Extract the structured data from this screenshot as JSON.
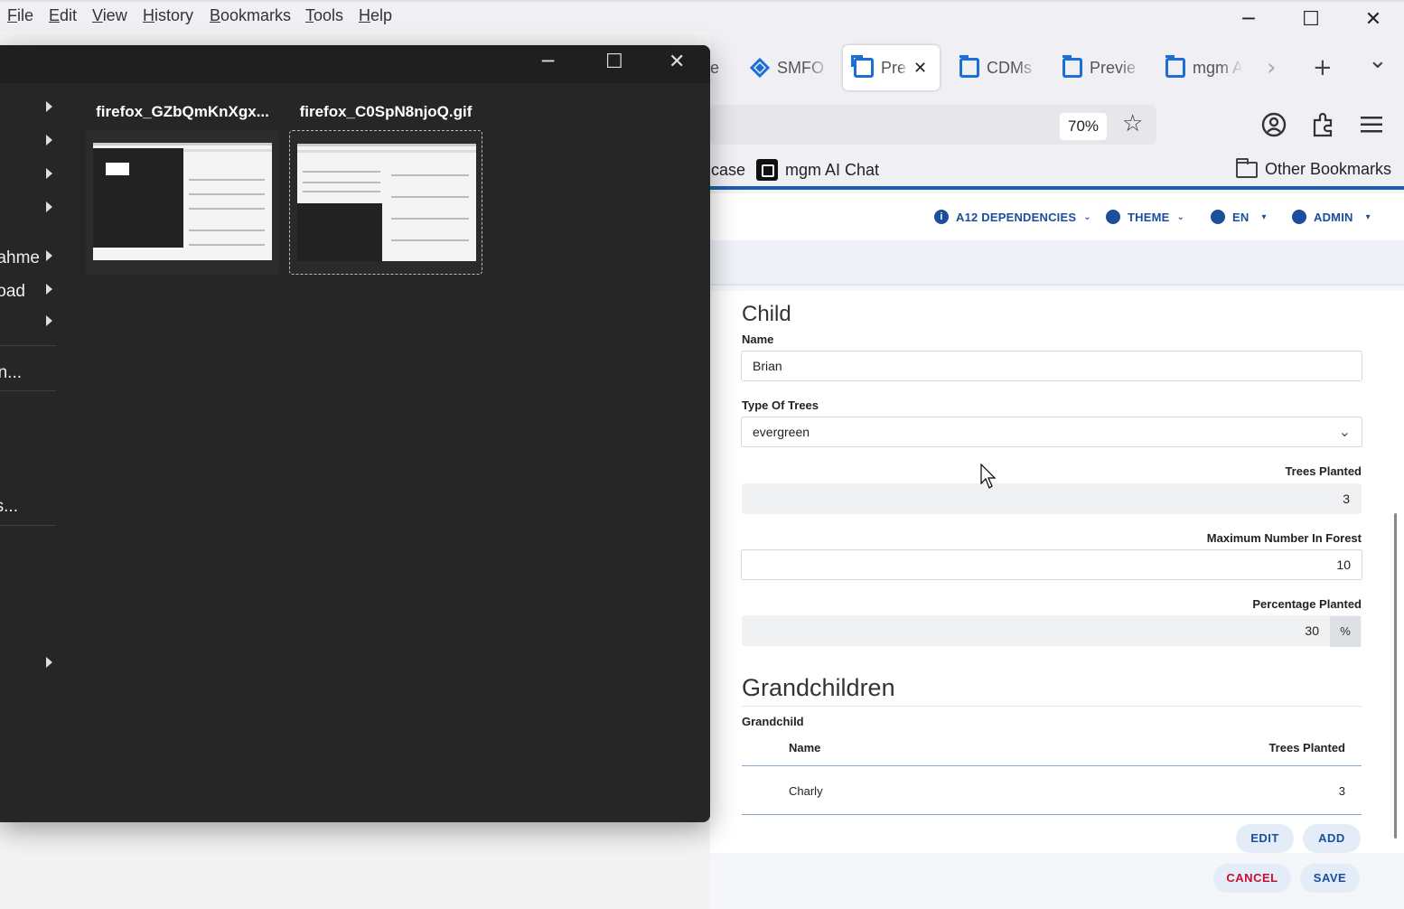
{
  "menubar": {
    "items": [
      "File",
      "Edit",
      "View",
      "History",
      "Bookmarks",
      "Tools",
      "Help"
    ]
  },
  "window_controls": {
    "minimize": "─",
    "maximize": "☐",
    "close": "✕"
  },
  "tabs": [
    {
      "label": "e",
      "icon": "none"
    },
    {
      "label": "SMFO",
      "icon": "jira-icon"
    },
    {
      "label": "Pre",
      "icon": "a12-square-icon",
      "active": true
    },
    {
      "label": "CDMs",
      "icon": "a12-square-icon"
    },
    {
      "label": "Previe",
      "icon": "a12-square-icon"
    },
    {
      "label": "mgm A",
      "icon": "a12-square-icon"
    }
  ],
  "tab_buttons": {
    "scroll_right": "›",
    "new_tab": "+",
    "list_all": "⌄"
  },
  "navbar": {
    "zoom": "70%"
  },
  "bookmarks": {
    "items": [
      "case",
      "mgm AI Chat"
    ],
    "other": "Other Bookmarks"
  },
  "app_header": {
    "dependencies": "A12 DEPENDENCIES",
    "theme": "THEME",
    "language": "EN",
    "user": "ADMIN"
  },
  "form": {
    "section_title": "Child",
    "name_label": "Name",
    "name_value": "Brian",
    "type_label": "Type Of Trees",
    "type_value": "evergreen",
    "trees_label": "Trees Planted",
    "trees_value": "3",
    "max_label": "Maximum Number In Forest",
    "max_value": "10",
    "pct_label": "Percentage Planted",
    "pct_value": "30",
    "pct_unit": "%",
    "grand_title": "Grandchildren",
    "grand_sub": "Grandchild",
    "table": {
      "headers": [
        "Name",
        "Trees Planted"
      ],
      "rows": [
        [
          "Charly",
          "3"
        ]
      ]
    },
    "edit_btn": "EDIT",
    "add_btn": "ADD",
    "cancel_btn": "CANCEL",
    "save_btn": "SAVE"
  },
  "dialog": {
    "sidebar": [
      {
        "text": "",
        "arrow": true
      },
      {
        "text": "",
        "arrow": true
      },
      {
        "text": "",
        "arrow": true
      },
      {
        "text": "",
        "arrow": true
      },
      {
        "text": "ahme",
        "arrow": true
      },
      {
        "text": "oad",
        "arrow": true
      },
      {
        "text": "",
        "arrow": true
      },
      {
        "text": "n...",
        "arrow": false
      },
      {
        "text": "s...",
        "arrow": false
      },
      {
        "text": "",
        "arrow": true
      }
    ],
    "files": [
      {
        "name": "firefox_GZbQmKnXgx..."
      },
      {
        "name": "firefox_C0SpN8njoQ.gif"
      }
    ]
  }
}
